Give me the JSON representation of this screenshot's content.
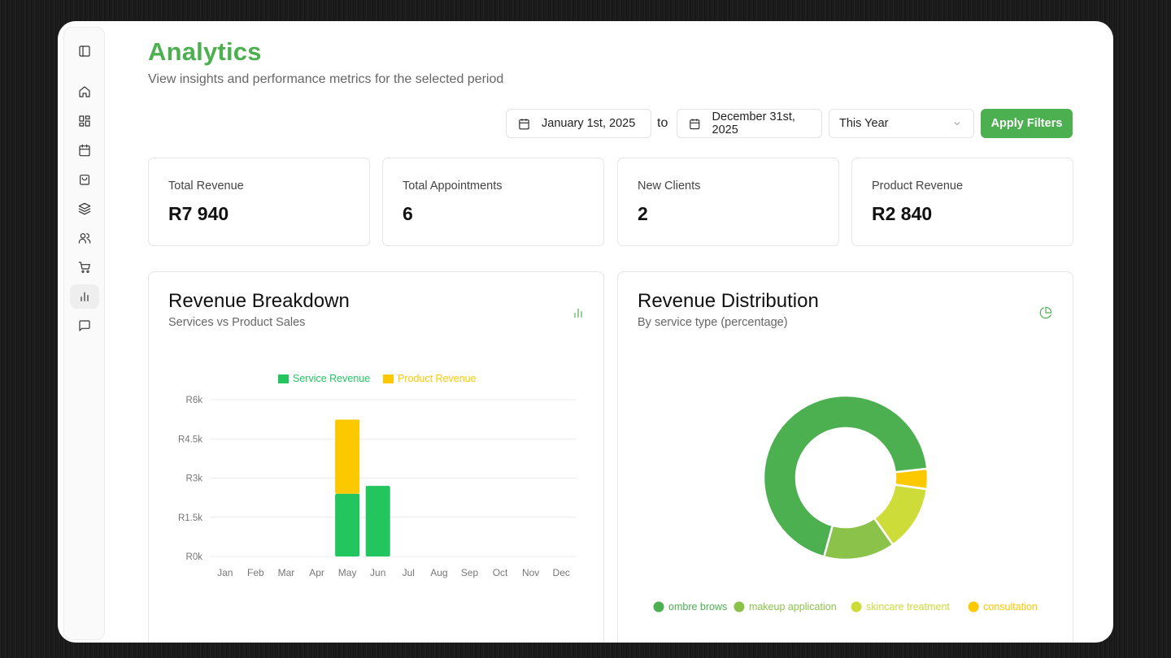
{
  "header": {
    "title": "Analytics",
    "subtitle": "View insights and performance metrics for the selected period"
  },
  "sidebar": {
    "items": [
      {
        "icon": "panel-toggle-icon"
      },
      {
        "icon": "home-icon"
      },
      {
        "icon": "dashboard-icon"
      },
      {
        "icon": "calendar-icon"
      },
      {
        "icon": "shopping-bag-icon"
      },
      {
        "icon": "layers-icon"
      },
      {
        "icon": "users-icon"
      },
      {
        "icon": "cart-icon"
      },
      {
        "icon": "bar-chart-icon",
        "active": true
      },
      {
        "icon": "message-icon"
      }
    ]
  },
  "filters": {
    "start_date": "January 1st, 2025",
    "to_label": "to",
    "end_date": "December 31st, 2025",
    "period": "This Year",
    "apply_label": "Apply Filters"
  },
  "stats": [
    {
      "label": "Total Revenue",
      "value": "R7 940"
    },
    {
      "label": "Total Appointments",
      "value": "6"
    },
    {
      "label": "New Clients",
      "value": "2"
    },
    {
      "label": "Product Revenue",
      "value": "R2 840"
    }
  ],
  "revenue_breakdown": {
    "title": "Revenue Breakdown",
    "subtitle": "Services vs Product Sales"
  },
  "revenue_distribution": {
    "title": "Revenue Distribution",
    "subtitle": "By service type (percentage)"
  },
  "colors": {
    "accent": "#4caf50",
    "service": "#22c55e",
    "product": "#fcc800"
  },
  "chart_data": [
    {
      "type": "bar",
      "stacked": true,
      "categories": [
        "Jan",
        "Feb",
        "Mar",
        "Apr",
        "May",
        "Jun",
        "Jul",
        "Aug",
        "Sep",
        "Oct",
        "Nov",
        "Dec"
      ],
      "series": [
        {
          "name": "Service Revenue",
          "color": "#22c55e",
          "values": [
            0,
            0,
            0,
            0,
            2400,
            2700,
            0,
            0,
            0,
            0,
            0,
            0
          ]
        },
        {
          "name": "Product Revenue",
          "color": "#fcc800",
          "values": [
            0,
            0,
            0,
            0,
            2840,
            0,
            0,
            0,
            0,
            0,
            0,
            0
          ]
        }
      ],
      "yticks": [
        "R0k",
        "R1.5k",
        "R3k",
        "R4.5k",
        "R6k"
      ],
      "ylim": [
        0,
        6000
      ],
      "legend": "top"
    },
    {
      "type": "pie",
      "donut": true,
      "labels": [
        "ombre brows",
        "makeup application",
        "skincare treatment",
        "consultation"
      ],
      "values": [
        69,
        14,
        13,
        4
      ],
      "colors": [
        "#4caf50",
        "#8bc34a",
        "#cddc39",
        "#fcc800"
      ],
      "legend": "bottom"
    }
  ]
}
